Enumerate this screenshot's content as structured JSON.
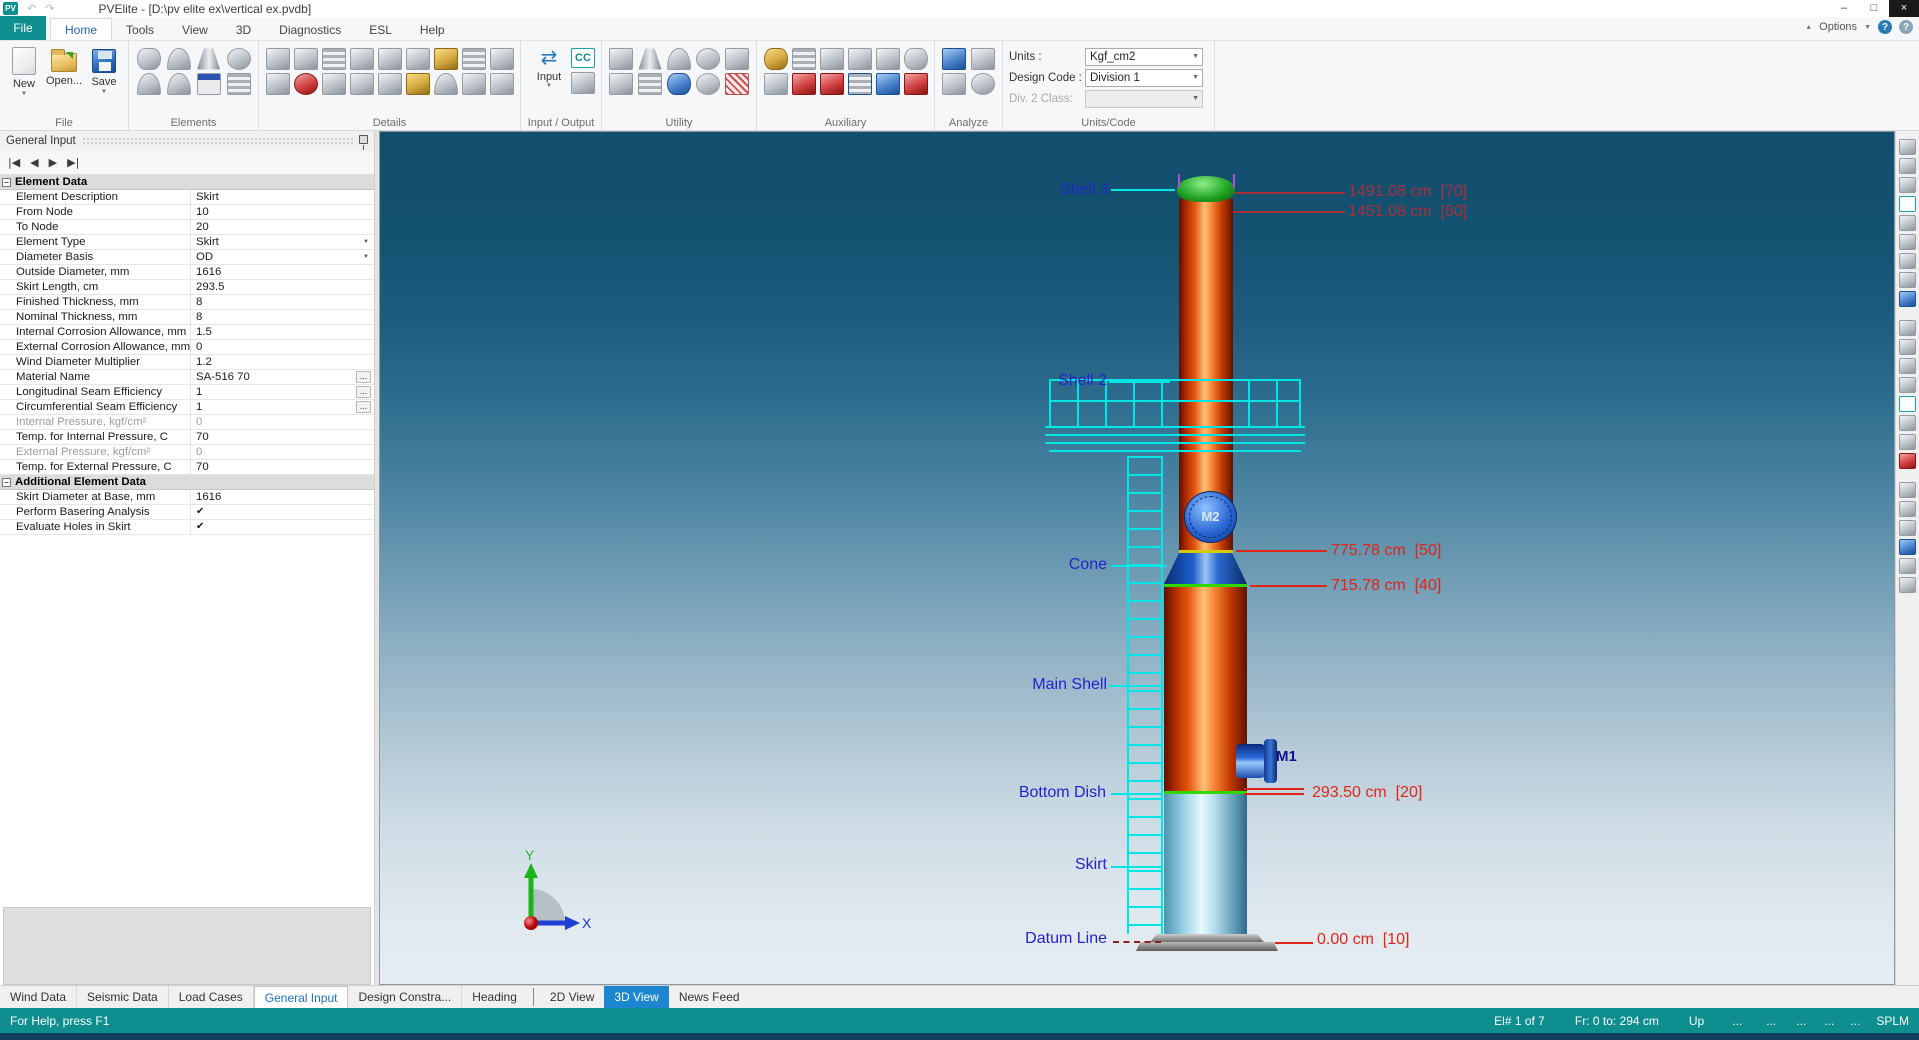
{
  "titlebar": {
    "logo": "PV",
    "title": "PVElite - [D:\\pv elite ex\\vertical ex.pvdb]"
  },
  "glyphs": {
    "undo": "↶",
    "redo": "↷",
    "minimize": "–",
    "maximize": "□",
    "close": "×",
    "dropdown": "▼",
    "up_chevron": "▲",
    "help": "?",
    "browse": "...",
    "minus": "–",
    "nav_first": "|◀",
    "nav_prev": "◀",
    "nav_next": "▶",
    "nav_last": "▶|",
    "swap": "⇄"
  },
  "menubar": {
    "file": "File",
    "tabs": [
      "Home",
      "Tools",
      "View",
      "3D",
      "Diagnostics",
      "ESL",
      "Help"
    ],
    "options": "Options"
  },
  "ribbon": {
    "group_labels": [
      "File",
      "Elements",
      "Details",
      "Input / Output",
      "Utility",
      "Auxiliary",
      "Analyze",
      "Units/Code"
    ],
    "file": {
      "new": "New",
      "open": "Open...",
      "save": "Save"
    },
    "input": {
      "label": "Input",
      "cc": "CC"
    },
    "units": {
      "units_label": "Units :",
      "units_value": "Kgf_cm2",
      "code_label": "Design Code :",
      "code_value": "Division 1",
      "class_label": "Div. 2 Class:",
      "class_value": ""
    }
  },
  "panel": {
    "title": "General Input",
    "sections": [
      {
        "title": "Element Data",
        "rows": [
          {
            "label": "Element Description",
            "value": "Skirt"
          },
          {
            "label": "From Node",
            "value": "10"
          },
          {
            "label": "To Node",
            "value": "20"
          },
          {
            "label": "Element Type",
            "value": "Skirt"
          },
          {
            "label": "Diameter Basis",
            "value": "OD"
          },
          {
            "label": "Outside Diameter, mm",
            "value": "1616"
          },
          {
            "label": "Skirt Length, cm",
            "value": "293.5"
          },
          {
            "label": "Finished Thickness, mm",
            "value": "8"
          },
          {
            "label": "Nominal Thickness, mm",
            "value": "8"
          },
          {
            "label": "Internal Corrosion Allowance, mm",
            "value": "1.5"
          },
          {
            "label": "External Corrosion Allowance, mm",
            "value": "0"
          },
          {
            "label": "Wind Diameter Multiplier",
            "value": "1.2"
          },
          {
            "label": "Material Name",
            "value": "SA-516 70"
          },
          {
            "label": "Longitudinal Seam Efficiency",
            "value": "1"
          },
          {
            "label": "Circumferential Seam Efficiency",
            "value": "1"
          },
          {
            "label": "Internal Pressure, kgf/cm²",
            "value": "0"
          },
          {
            "label": "Temp. for Internal Pressure, C",
            "value": "70"
          },
          {
            "label": "External Pressure, kgf/cm²",
            "value": "0"
          },
          {
            "label": "Temp. for External Pressure, C",
            "value": "70"
          }
        ]
      },
      {
        "title": "Additional Element Data",
        "rows": [
          {
            "label": "Skirt Diameter at Base, mm",
            "value": "1616"
          },
          {
            "label": "Perform Basering Analysis",
            "value": "✔"
          },
          {
            "label": "Evaluate Holes in Skirt",
            "value": "✔"
          }
        ]
      }
    ]
  },
  "scene": {
    "labels": {
      "shell3": "Shell 3",
      "shell2": "Shell 2",
      "cone": "Cone",
      "main_shell": "Main Shell",
      "bottom_dish": "Bottom Dish",
      "skirt": "Skirt",
      "datum": "Datum Line",
      "m1": "M1",
      "m2": "M2"
    },
    "dims": {
      "d70": "1491.08 cm  [70]",
      "d60": "1451.08 cm  [60]",
      "d50": "775.78 cm  [50]",
      "d40": "715.78 cm  [40]",
      "d20": "293.50 cm  [20]",
      "d10": "0.00 cm  [10]"
    },
    "axis": {
      "x": "X",
      "y": "Y"
    }
  },
  "bottom_tabs": [
    "Wind Data",
    "Seismic Data",
    "Load Cases",
    "General Input",
    "Design Constra...",
    "Heading"
  ],
  "view_tabs": [
    "2D View",
    "3D View",
    "News Feed"
  ],
  "statusbar": {
    "help": "For Help, press F1",
    "element": "El# 1 of 7",
    "range": "Fr: 0 to: 294 cm",
    "up": "Up",
    "dots": "...",
    "brand": "SPLM"
  },
  "colors": {
    "accent_teal": "#0e8e8e",
    "active_tab_blue": "#1c86d1",
    "label_blue": "#2323cc",
    "dim_red": "#e02418",
    "cyan": "#00e6e6"
  }
}
